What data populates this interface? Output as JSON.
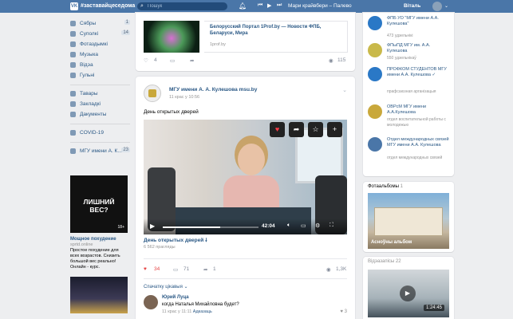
{
  "header": {
    "logo": "VK",
    "hashtag": "#заставайцеседома",
    "search_placeholder": "Пошук",
    "track": "Мари крайвбери – Палево",
    "user_name": "Віталь"
  },
  "sidebar": {
    "items": [
      {
        "label": "Сябры",
        "count": "1"
      },
      {
        "label": "Суполкі",
        "count": "14"
      },
      {
        "label": "Фотаздымкі",
        "count": ""
      },
      {
        "label": "Музыка",
        "count": ""
      },
      {
        "label": "Відэа",
        "count": ""
      },
      {
        "label": "Гульні",
        "count": ""
      }
    ],
    "items2": [
      {
        "label": "Тавары"
      },
      {
        "label": "Закладкі"
      },
      {
        "label": "Дакументы"
      }
    ],
    "covid": "COVID-19",
    "group": {
      "label": "МГУ имени А. К...",
      "count": "23"
    }
  },
  "ad": {
    "image_text": "ЛИШНИЙ ВЕС?",
    "age": "18+",
    "title": "Мощное похудение",
    "domain": "sprtd.online",
    "text": "Простое похудение для всех возрастов. Снизить большой вес реально! Онлайн - курс."
  },
  "feed1": {
    "link_title": "Белорусский Портал 1Prof.by — Новости ФПБ, Беларуси, Мира",
    "link_domain": "1prof.by",
    "likes": "4",
    "views": "115"
  },
  "post": {
    "author": "МГУ имени А. А. Кулешова msu.by",
    "time": "11 крас у 10:56",
    "text": "День открытых дверей",
    "video": {
      "duration": "42:04",
      "progress": 0.6,
      "title": "День открытых дверей 🠗",
      "views": "6 562 прагляды"
    },
    "likes": "34",
    "comments": "71",
    "shares": "1",
    "views": "1,3K",
    "sort_label": "Спачатку цікавыя ⌄",
    "comment": {
      "author": "Юрий Луца",
      "text": "когда Наталья Михайловна будет?",
      "time": "11 крас у 11:11",
      "reply": "Адказаць",
      "likes": "3"
    }
  },
  "groups": [
    {
      "name": "ФПБ УО \"МГУ имени А.А. Кулешова\"",
      "sub": "473 удзельнікі",
      "color": "#2a78c6"
    },
    {
      "name": "ФПыПД МГУ им. А.А. Кулешова",
      "sub": "550 удзельнікаў",
      "color": "#c9b94a"
    },
    {
      "name": "ПРОФКОМ СТУДЕНТОВ МГУ имени А.А. Кулешова ✓",
      "sub": "прафсаюзная арганізацыя",
      "color": "#2a78c6"
    },
    {
      "name": "ОВРсМ МГУ имени А.А.Кулешова",
      "sub": "отдел воспитательной работы с молодежью",
      "color": "#c9a83b"
    },
    {
      "name": "Отдел международных связей МГУ имени А.А. Кулешова",
      "sub": "отдел международных связей",
      "color": "#4a76a8"
    }
  ],
  "photos": {
    "title": "Фотаальбомы",
    "count": "1",
    "caption": "Асноўны альбом"
  },
  "videos": {
    "title": "Відэазапісы",
    "count": "22",
    "duration": "1:24:45"
  }
}
